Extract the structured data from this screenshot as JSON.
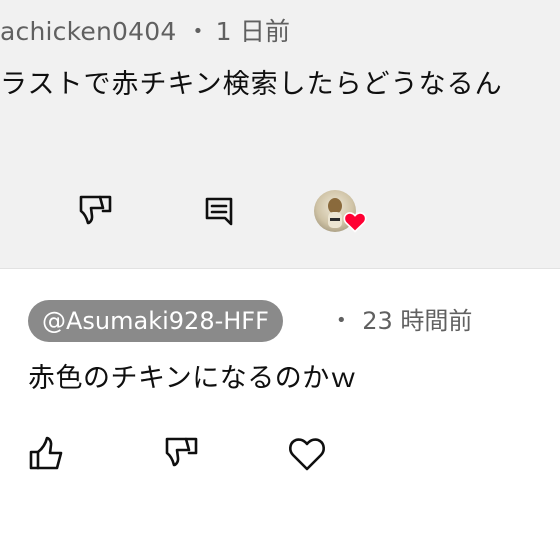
{
  "parent_comment": {
    "author": "achicken0404",
    "separator": "•",
    "time": "1 日前",
    "text": "ラストで赤チキン検索したらどうなるん"
  },
  "reply": {
    "author": "@Asumaki928-HFF",
    "separator": "•",
    "time": "23 時間前",
    "text": "赤色のチキンになるのかｗ"
  },
  "icons": {
    "parent_actions": [
      "dislike-icon",
      "reply-icon",
      "creator-heart-avatar"
    ],
    "reply_actions": [
      "like-icon",
      "dislike-icon",
      "heart-icon"
    ]
  },
  "colors": {
    "top_background": "#f1f1f1",
    "author_pill": "#8a8a8a",
    "creator_heart": "#ff0033",
    "secondary_text": "#606060"
  }
}
